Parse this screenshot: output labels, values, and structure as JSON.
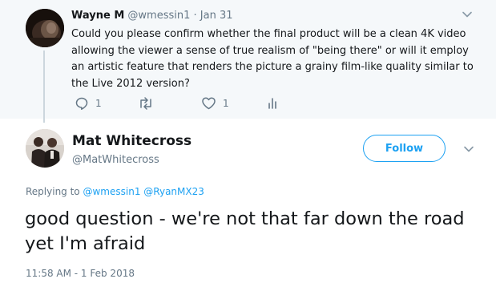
{
  "parent_tweet": {
    "author_name": "Wayne M",
    "author_handle": "@wmessin1",
    "separator": "·",
    "date": "Jan 31",
    "text": "Could you please confirm whether the final product will be a clean 4K video allowing the viewer a sense of true realism of \"being there\" or will it employ an artistic feature that renders the picture a grainy film-like quality similar to the Live 2012 version?",
    "actions": {
      "reply_count": "1",
      "retweet_count": "",
      "like_count": "1"
    },
    "icons": [
      "reply-icon",
      "retweet-icon",
      "like-icon",
      "analytics-icon",
      "chevron-down-icon"
    ]
  },
  "main_tweet": {
    "author_name": "Mat Whitecross",
    "author_handle": "@MatWhitecross",
    "follow_label": "Follow",
    "replying_prefix": "Replying to",
    "replying_to_1": "@wmessin1",
    "replying_to_2": "@RyanMX23",
    "text": "good question - we're not that far down the road yet I'm afraid",
    "timestamp": "11:58 AM - 1 Feb 2018"
  },
  "colors": {
    "accent": "#1da1f2",
    "secondary_text": "#657786",
    "primary_text": "#14171a",
    "parent_background": "#f5f8fa",
    "thread_line": "#ccd6dd"
  }
}
